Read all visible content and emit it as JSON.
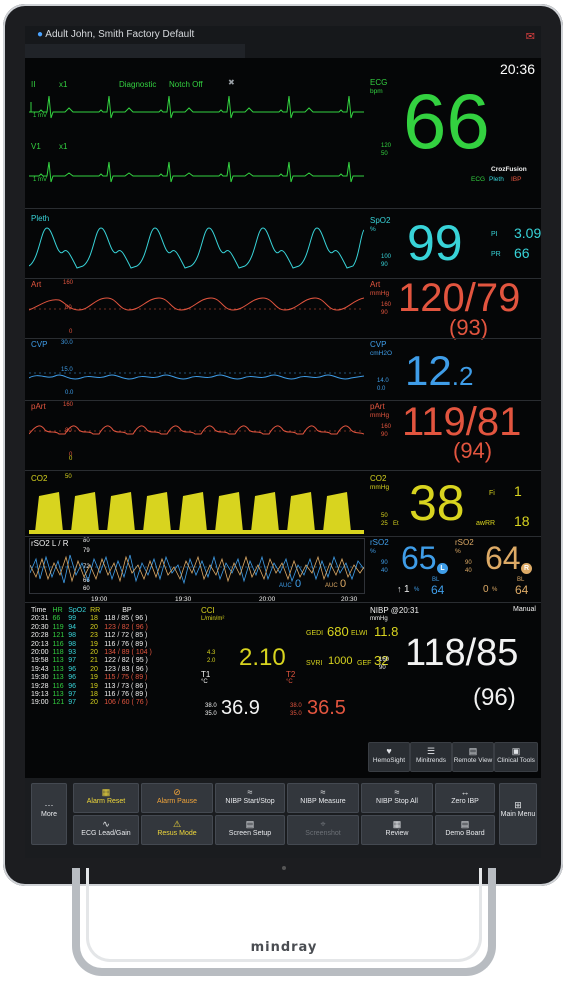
{
  "header": {
    "patient": "Adult  John, Smith Factory Default",
    "time": "20:36"
  },
  "ecg": {
    "lead1": "II",
    "gain1": "x1",
    "mode": "Diagnostic",
    "notch": "Notch Off",
    "lead2": "V1",
    "gain2": "x1",
    "mv": "1 mV",
    "label": "ECG",
    "unit": "bpm",
    "hi": "120",
    "lo": "50",
    "value": "66",
    "fusion": "CrozFusion",
    "fusion_ecg": "ECG",
    "fusion_pleth": "Pleth",
    "fusion_ibp": "IBP"
  },
  "spo2": {
    "wave": "Pleth",
    "label": "SpO2",
    "unit": "%",
    "hi": "100",
    "lo": "90",
    "value": "99",
    "pi_label": "PI",
    "pi": "3.09",
    "pr_label": "PR",
    "pr": "66"
  },
  "art": {
    "wave": "Art",
    "scale": "160",
    "mid": "80",
    "zero": "0",
    "label": "Art",
    "unit": "mmHg",
    "hi": "160",
    "lo": "90",
    "value": "120/79",
    "mean": "(93)"
  },
  "cvp": {
    "wave": "CVP",
    "scale": "30.0",
    "mid": "15.0",
    "zero": "0.0",
    "label": "CVP",
    "unit": "cmH2O",
    "hi": "14.0",
    "lo": "0.0",
    "value_int": "12",
    "value_dec": ".2"
  },
  "part": {
    "wave": "pArt",
    "scale": "160",
    "mid": "80",
    "zero": "0",
    "label": "pArt",
    "unit": "mmHg",
    "hi": "160",
    "lo": "90",
    "value": "119/81",
    "mean": "(94)"
  },
  "co2": {
    "wave": "CO2",
    "scale": "50",
    "zero": "0",
    "label": "CO2",
    "unit": "mmHg",
    "hi": "50",
    "lo": "25",
    "et": "Et",
    "value": "38",
    "fi_label": "Fi",
    "fi": "1",
    "awrr_label": "awRR",
    "awrr": "18"
  },
  "rso2": {
    "wave": "rSO2 L / R",
    "scales": [
      "80",
      "79",
      "72",
      "66",
      "60"
    ],
    "times": [
      "19:00",
      "19:30",
      "20:00",
      "20:30"
    ],
    "auc_label": "AUC",
    "auc_l": "0",
    "auc_r": "0",
    "label_l": "rSO2",
    "unit_l": "%",
    "hi_l": "90",
    "lo_l": "40",
    "value_l": "65",
    "badge_l": "L",
    "bl_label_l": "BL",
    "bl_l": "64",
    "delta_l": "1",
    "label_r": "rSO2",
    "unit_r": "%",
    "hi_r": "90",
    "lo_r": "40",
    "value_r": "64",
    "badge_r": "R",
    "bl_label_r": "BL",
    "bl_r": "64",
    "delta_r": "0"
  },
  "trend": {
    "headers": [
      "Time",
      "HR",
      "SpO2",
      "RR",
      "BP"
    ],
    "rows": [
      [
        "20:31",
        "66",
        "99",
        "18",
        "118",
        "85",
        "96"
      ],
      [
        "20:30",
        "119",
        "94",
        "20",
        "123",
        "82",
        "96"
      ],
      [
        "20:28",
        "121",
        "98",
        "23",
        "112",
        "72",
        "85"
      ],
      [
        "20:13",
        "116",
        "98",
        "19",
        "116",
        "76",
        "89"
      ],
      [
        "20:00",
        "118",
        "93",
        "20",
        "134",
        "89",
        "104"
      ],
      [
        "19:58",
        "113",
        "97",
        "21",
        "122",
        "82",
        "95"
      ],
      [
        "19:43",
        "113",
        "96",
        "20",
        "123",
        "83",
        "96"
      ],
      [
        "19:30",
        "113",
        "96",
        "19",
        "115",
        "75",
        "89"
      ],
      [
        "19:28",
        "116",
        "96",
        "19",
        "113",
        "73",
        "86"
      ],
      [
        "19:13",
        "113",
        "97",
        "18",
        "116",
        "76",
        "89"
      ],
      [
        "19:00",
        "121",
        "97",
        "20",
        "106",
        "60",
        "76"
      ]
    ]
  },
  "hemo": {
    "cci": "CCI",
    "cci_unit": "L/min/m²",
    "cci_hi": "4.3",
    "cci_lo": "2.0",
    "cci_value": "2.10",
    "gedi_label": "GEDI",
    "gedi": "680",
    "elwi_label": "ELWI",
    "elwi": "11.8",
    "svri_label": "SVRI",
    "svri": "1000",
    "gef_label": "GEF",
    "gef": "32",
    "t1_label": "T1",
    "t1_unit": "°C",
    "t1_hi": "38.0",
    "t1_lo": "35.0",
    "t1": "36.9",
    "t2_label": "T2",
    "t2_unit": "°C",
    "t2_hi": "38.0",
    "t2_lo": "35.0",
    "t2": "36.5"
  },
  "nibp": {
    "label": "NIBP @20:31",
    "unit": "mmHg",
    "mode": "Manual",
    "hi": "160",
    "lo": "90",
    "value": "118/85",
    "mean": "(96)"
  },
  "quickkeys": [
    "HemoSight",
    "Minitrends",
    "Remote View",
    "Clinical Tools"
  ],
  "softkeys": {
    "more": "More",
    "alarm_reset": "Alarm Reset",
    "alarm_pause": "Alarm Pause",
    "nibp_start": "NIBP Start/Stop",
    "nibp_measure": "NIBP Measure",
    "nibp_stop_all": "NIBP Stop All",
    "zero_ibp": "Zero IBP",
    "ecg_lead": "ECG Lead/Gain",
    "resus": "Resus Mode",
    "screen_setup": "Screen Setup",
    "screenshot": "Screenshot",
    "review": "Review",
    "demo": "Demo Board",
    "main_menu": "Main Menu"
  },
  "device": {
    "brand": "mindray"
  },
  "colors": {
    "ecg": "#33d140",
    "spo2": "#38d3d8",
    "ibp": "#e2553f",
    "cvp": "#3f9de8",
    "co2": "#d8d41f",
    "rso2_r": "#ddaa66"
  }
}
